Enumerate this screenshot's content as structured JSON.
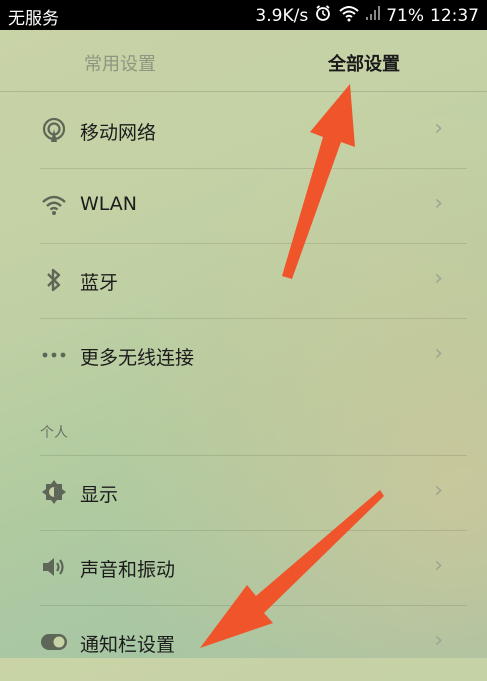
{
  "status_bar": {
    "carrier": "无服务",
    "speed": "3.9K/s",
    "battery": "71%",
    "time": "12:37",
    "icons": [
      "alarm-icon",
      "wifi-icon",
      "signal-icon"
    ]
  },
  "tabs": [
    {
      "label": "常用设置",
      "active": false
    },
    {
      "label": "全部设置",
      "active": true
    }
  ],
  "sections": {
    "personal_header": "个人"
  },
  "items": [
    {
      "label": "移动网络",
      "icon": "mobile-network-icon"
    },
    {
      "label": "WLAN",
      "icon": "wifi-icon"
    },
    {
      "label": "蓝牙",
      "icon": "bluetooth-icon"
    },
    {
      "label": "更多无线连接",
      "icon": "more-icon"
    },
    {
      "label": "显示",
      "icon": "display-icon"
    },
    {
      "label": "声音和振动",
      "icon": "sound-icon"
    },
    {
      "label": "通知栏设置",
      "icon": "notification-toggle-icon"
    }
  ],
  "chevron": "›",
  "colors": {
    "arrow": "#f0542a"
  }
}
